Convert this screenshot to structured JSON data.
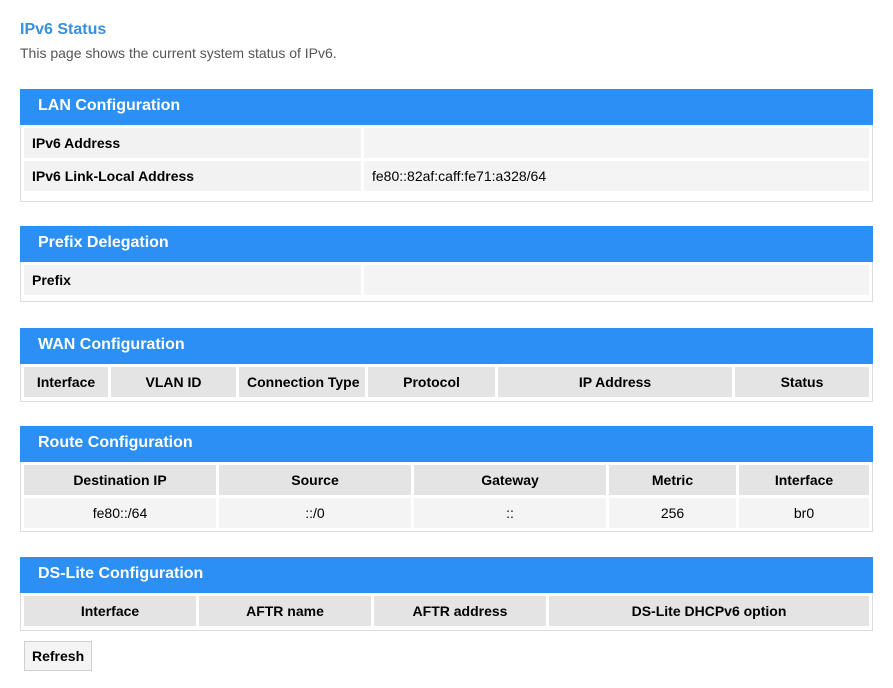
{
  "page": {
    "title": "IPv6 Status",
    "description": "This page shows the current system status of IPv6."
  },
  "lan": {
    "header": "LAN Configuration",
    "rows": [
      {
        "label": "IPv6 Address",
        "value": ""
      },
      {
        "label": "IPv6 Link-Local Address",
        "value": "fe80::82af:caff:fe71:a328/64"
      }
    ]
  },
  "prefix": {
    "header": "Prefix Delegation",
    "rows": [
      {
        "label": "Prefix",
        "value": ""
      }
    ]
  },
  "wan": {
    "header": "WAN Configuration",
    "columns": [
      "Interface",
      "VLAN ID",
      "Connection Type",
      "Protocol",
      "IP Address",
      "Status"
    ]
  },
  "route": {
    "header": "Route Configuration",
    "columns": [
      "Destination IP",
      "Source",
      "Gateway",
      "Metric",
      "Interface"
    ],
    "rows": [
      [
        "fe80::/64",
        "::/0",
        "::",
        "256",
        "br0"
      ]
    ]
  },
  "dslite": {
    "header": "DS-Lite Configuration",
    "columns": [
      "Interface",
      "AFTR name",
      "AFTR address",
      "DS-Lite DHCPv6 option"
    ]
  },
  "actions": {
    "refresh_label": "Refresh"
  },
  "colors": {
    "accent": "#2b8ff3",
    "title": "#3a8fdc"
  }
}
